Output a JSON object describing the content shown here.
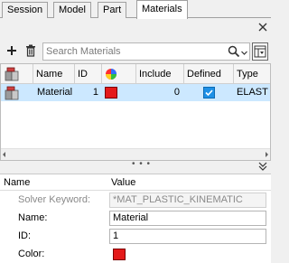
{
  "tabs": [
    {
      "label": "Session"
    },
    {
      "label": "Model"
    },
    {
      "label": "Part"
    },
    {
      "label": "Materials"
    }
  ],
  "toolbar": {
    "search_placeholder": "Search Materials"
  },
  "table": {
    "columns": [
      "Name",
      "ID",
      "",
      "Include",
      "Defined",
      "Type"
    ],
    "rows": [
      {
        "name": "Material",
        "id": "1",
        "color": "#e41a1a",
        "include": "0",
        "defined": true,
        "type": "ELAST"
      }
    ]
  },
  "splitter": {
    "dots": "• • •"
  },
  "properties": {
    "header": {
      "name": "Name",
      "value": "Value"
    },
    "rows": [
      {
        "label": "Solver Keyword:",
        "value": "*MAT_PLASTIC_KINEMATIC",
        "disabled": true
      },
      {
        "label": "Name:",
        "value": "Material"
      },
      {
        "label": "ID:",
        "value": "1"
      },
      {
        "label": "Color:",
        "color": "#e41a1a"
      }
    ]
  },
  "colors": {
    "selection": "#cce8ff",
    "swatch": "#e41a1a",
    "checkbox": "#1e90e6"
  }
}
